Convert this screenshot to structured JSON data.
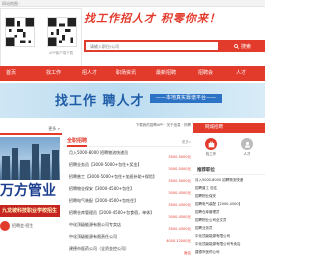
{
  "topstrip": {
    "text": "网站地图 ·"
  },
  "qr_popup": {
    "captions": [
      "",
      "APP客户端下载"
    ]
  },
  "header": {
    "slogan": "找工作招人才  积零你来！",
    "search_placeholder": "请输入职位/公司",
    "search_button": "搜索"
  },
  "nav": {
    "items": [
      "首页",
      "找工作",
      "招人才",
      "职场资讯",
      "最新招聘",
      "招聘会",
      "人才"
    ]
  },
  "banner": {
    "title": "找工作  聘人才",
    "subtitle": "——本地真实靠谱平台——"
  },
  "left_ad": {
    "header_more": "更多 »",
    "brand": "万方管业",
    "banner2": "九龙坡科技职业学校招生",
    "icon_label": "招聘会·招生"
  },
  "middle": {
    "sub_links": "下载我的招聘APP · 关于信息 · 热聘",
    "tab": "全职招聘",
    "more": "更多»",
    "jobs": [
      {
        "title": "月入5000-8000 招聘物流快递员",
        "sub": "",
        "salary": "3000-5000元"
      },
      {
        "title": "招聘业务员【3000-5000+包住+奖金】",
        "sub": "",
        "salary": "3000-5000元"
      },
      {
        "title": "招聘普工【3000-5000+包住+加班补助+保险】",
        "sub": "",
        "salary": "3000-5000元"
      },
      {
        "title": "招聘物业保安【3000-4500+包住】",
        "sub": "",
        "salary": "3000-4500元"
      },
      {
        "title": "招聘电气装配【2000-4500+包吃住】",
        "sub": "",
        "salary": "3000-4500元"
      },
      {
        "title": "招聘仓库管理员【2000-4500+包食宿，单休】",
        "sub": "",
        "salary": "3000-4500元"
      },
      {
        "title": "中化顶级能源有限公司专卖店",
        "sub": "",
        "salary": "3000-4500元"
      },
      {
        "title": "中化顶级能源有限责任公司",
        "sub": "",
        "salary": "4000-12000元"
      },
      {
        "title": "建德市医药公司（全资金控公司）",
        "sub": "",
        "salary": "面议"
      }
    ]
  },
  "right": {
    "header": "网城招聘",
    "icons": [
      {
        "label": "找工作"
      },
      {
        "label": "人才"
      }
    ],
    "sub_title": "推荐职位",
    "items": [
      "月入5000-8000 招聘物流快递",
      "招聘普工 包住",
      "招聘物业保安",
      "招聘电气装配【2000-4500】",
      "招聘仓库管理员",
      "招聘物业公司全文员",
      "招聘业务员",
      "中化顶级能源有限公司",
      "中化顶级能源有限公司专卖店",
      "建德市医药公司"
    ]
  },
  "colors": {
    "accent": "#e23b2c",
    "banner_blue": "#1f5ca8"
  }
}
